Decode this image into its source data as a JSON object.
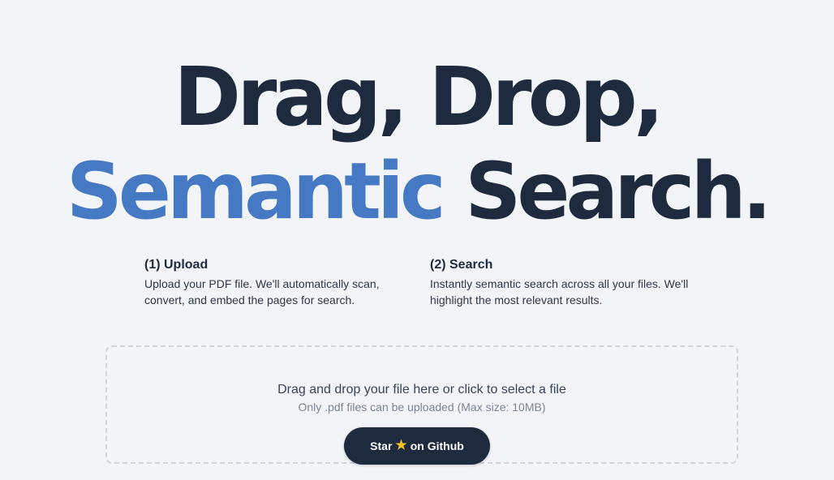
{
  "hero": {
    "line1": "Drag, Drop,",
    "line2_accent": "Semantic",
    "line2_rest": "Search."
  },
  "steps": [
    {
      "title": "(1) Upload",
      "description": "Upload your PDF file. We'll automatically scan, convert, and embed the pages for search."
    },
    {
      "title": "(2) Search",
      "description": "Instantly semantic search across all your files. We'll highlight the most relevant results."
    }
  ],
  "dropzone": {
    "main_text": "Drag and drop your file here or click to select a file",
    "sub_text": "Only .pdf files can be uploaded (Max size: 10MB)"
  },
  "github_button": {
    "prefix": "Star",
    "icon": "star-icon",
    "suffix": "on Github"
  },
  "colors": {
    "background": "#f2f4f7",
    "dark": "#1e2a3d",
    "accent": "#4579c4"
  }
}
